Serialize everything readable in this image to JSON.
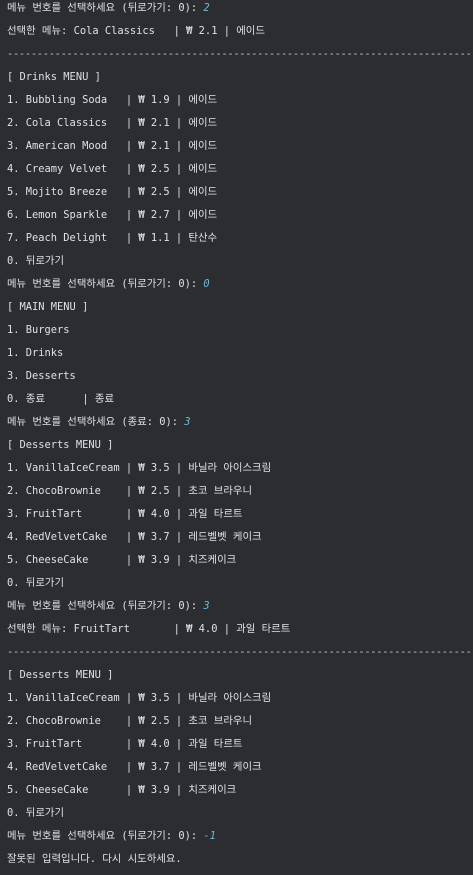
{
  "console": {
    "lines": [
      {
        "text": "메뉴 번호를 선택하세요 (뒤로가기: 0): ",
        "input": "2"
      },
      {
        "text": "선택한 메뉴: Cola Classics   | ₩ 2.1 | 에이드"
      },
      {
        "text": "------------------------------------------------------------------------------",
        "kind": "sep"
      },
      {
        "text": "[ Drinks MENU ]"
      },
      {
        "text": "1. Bubbling Soda   | ₩ 1.9 | 에이드"
      },
      {
        "text": "2. Cola Classics   | ₩ 2.1 | 에이드"
      },
      {
        "text": "3. American Mood   | ₩ 2.1 | 에이드"
      },
      {
        "text": "4. Creamy Velvet   | ₩ 2.5 | 에이드"
      },
      {
        "text": "5. Mojito Breeze   | ₩ 2.5 | 에이드"
      },
      {
        "text": "6. Lemon Sparkle   | ₩ 2.7 | 에이드"
      },
      {
        "text": "7. Peach Delight   | ₩ 1.1 | 탄산수"
      },
      {
        "text": "0. 뒤로가기"
      },
      {
        "text": "메뉴 번호를 선택하세요 (뒤로가기: 0): ",
        "input": "0"
      },
      {
        "text": "[ MAIN MENU ]"
      },
      {
        "text": "1. Burgers"
      },
      {
        "text": "1. Drinks"
      },
      {
        "text": "3. Desserts"
      },
      {
        "text": "0. 종료      | 종료"
      },
      {
        "text": "메뉴 번호를 선택하세요 (종료: 0): ",
        "input": "3"
      },
      {
        "text": "[ Desserts MENU ]"
      },
      {
        "text": "1. VanillaIceCream | ₩ 3.5 | 바닐라 아이스크림"
      },
      {
        "text": "2. ChocoBrownie    | ₩ 2.5 | 초코 브라우니"
      },
      {
        "text": "3. FruitTart       | ₩ 4.0 | 과일 타르트"
      },
      {
        "text": "4. RedVelvetCake   | ₩ 3.7 | 레드벨벳 케이크"
      },
      {
        "text": "5. CheeseCake      | ₩ 3.9 | 치즈케이크"
      },
      {
        "text": "0. 뒤로가기"
      },
      {
        "text": "메뉴 번호를 선택하세요 (뒤로가기: 0): ",
        "input": "3"
      },
      {
        "text": "선택한 메뉴: FruitTart       | ₩ 4.0 | 과일 타르트"
      },
      {
        "text": "------------------------------------------------------------------------------",
        "kind": "sep"
      },
      {
        "text": "[ Desserts MENU ]"
      },
      {
        "text": "1. VanillaIceCream | ₩ 3.5 | 바닐라 아이스크림"
      },
      {
        "text": "2. ChocoBrownie    | ₩ 2.5 | 초코 브라우니"
      },
      {
        "text": "3. FruitTart       | ₩ 4.0 | 과일 타르트"
      },
      {
        "text": "4. RedVelvetCake   | ₩ 3.7 | 레드벨벳 케이크"
      },
      {
        "text": "5. CheeseCake      | ₩ 3.9 | 치즈케이크"
      },
      {
        "text": "0. 뒤로가기"
      },
      {
        "text": "메뉴 번호를 선택하세요 (뒤로가기: 0): ",
        "input": "-1"
      },
      {
        "text": "잘못된 입력입니다. 다시 시도하세요."
      }
    ]
  },
  "colors": {
    "background": "#2b2d30",
    "text": "#dfe1e5",
    "user_input": "#6fb7d8"
  }
}
